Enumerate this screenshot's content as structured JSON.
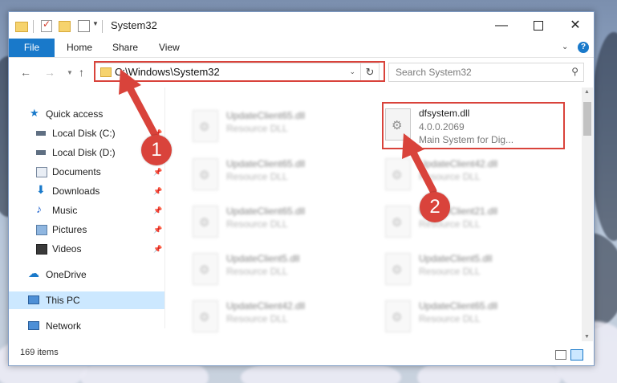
{
  "window": {
    "title": "System32"
  },
  "ribbon": {
    "tabs": [
      "File",
      "Home",
      "Share",
      "View"
    ]
  },
  "address": {
    "path": "C:\\Windows\\System32"
  },
  "search": {
    "placeholder": "Search System32"
  },
  "sidebar": {
    "items": [
      {
        "label": "Quick access",
        "icon": "star-icon",
        "pinned": false
      },
      {
        "label": "Local Disk (C:)",
        "icon": "drive-icon",
        "pinned": true
      },
      {
        "label": "Local Disk (D:)",
        "icon": "drive-icon",
        "pinned": false
      },
      {
        "label": "Documents",
        "icon": "documents-icon",
        "pinned": true
      },
      {
        "label": "Downloads",
        "icon": "download-icon",
        "pinned": true
      },
      {
        "label": "Music",
        "icon": "music-icon",
        "pinned": true
      },
      {
        "label": "Pictures",
        "icon": "pictures-icon",
        "pinned": true
      },
      {
        "label": "Videos",
        "icon": "videos-icon",
        "pinned": true
      },
      {
        "label": "OneDrive",
        "icon": "cloud-icon",
        "pinned": false
      },
      {
        "label": "This PC",
        "icon": "computer-icon",
        "pinned": false,
        "selected": true
      },
      {
        "label": "Network",
        "icon": "network-icon",
        "pinned": false
      }
    ]
  },
  "files": [
    {
      "name": "UpdateClient65.dll",
      "type": "Resource DLL"
    },
    {
      "name": "dfsystem.dll",
      "version": "4.0.0.2069",
      "description": "Main System for Dig..."
    },
    {
      "name": "UpdateClient65.dll",
      "type": "Resource DLL"
    },
    {
      "name": "UpdateClient42.dll",
      "type": "Resource DLL"
    },
    {
      "name": "UpdateClient65.dll",
      "type": "Resource DLL"
    },
    {
      "name": "UpdateClient21.dll",
      "type": "Resource DLL"
    },
    {
      "name": "UpdateClient5.dll",
      "type": "Resource DLL"
    },
    {
      "name": "UpdateClient5.dll",
      "type": "Resource DLL"
    },
    {
      "name": "UpdateClient42.dll",
      "type": "Resource DLL"
    },
    {
      "name": "UpdateClient65.dll",
      "type": "Resource DLL"
    }
  ],
  "status": {
    "item_count": "169 items"
  },
  "annotations": {
    "step1": "1",
    "step2": "2",
    "highlight_color": "#d9433b"
  }
}
